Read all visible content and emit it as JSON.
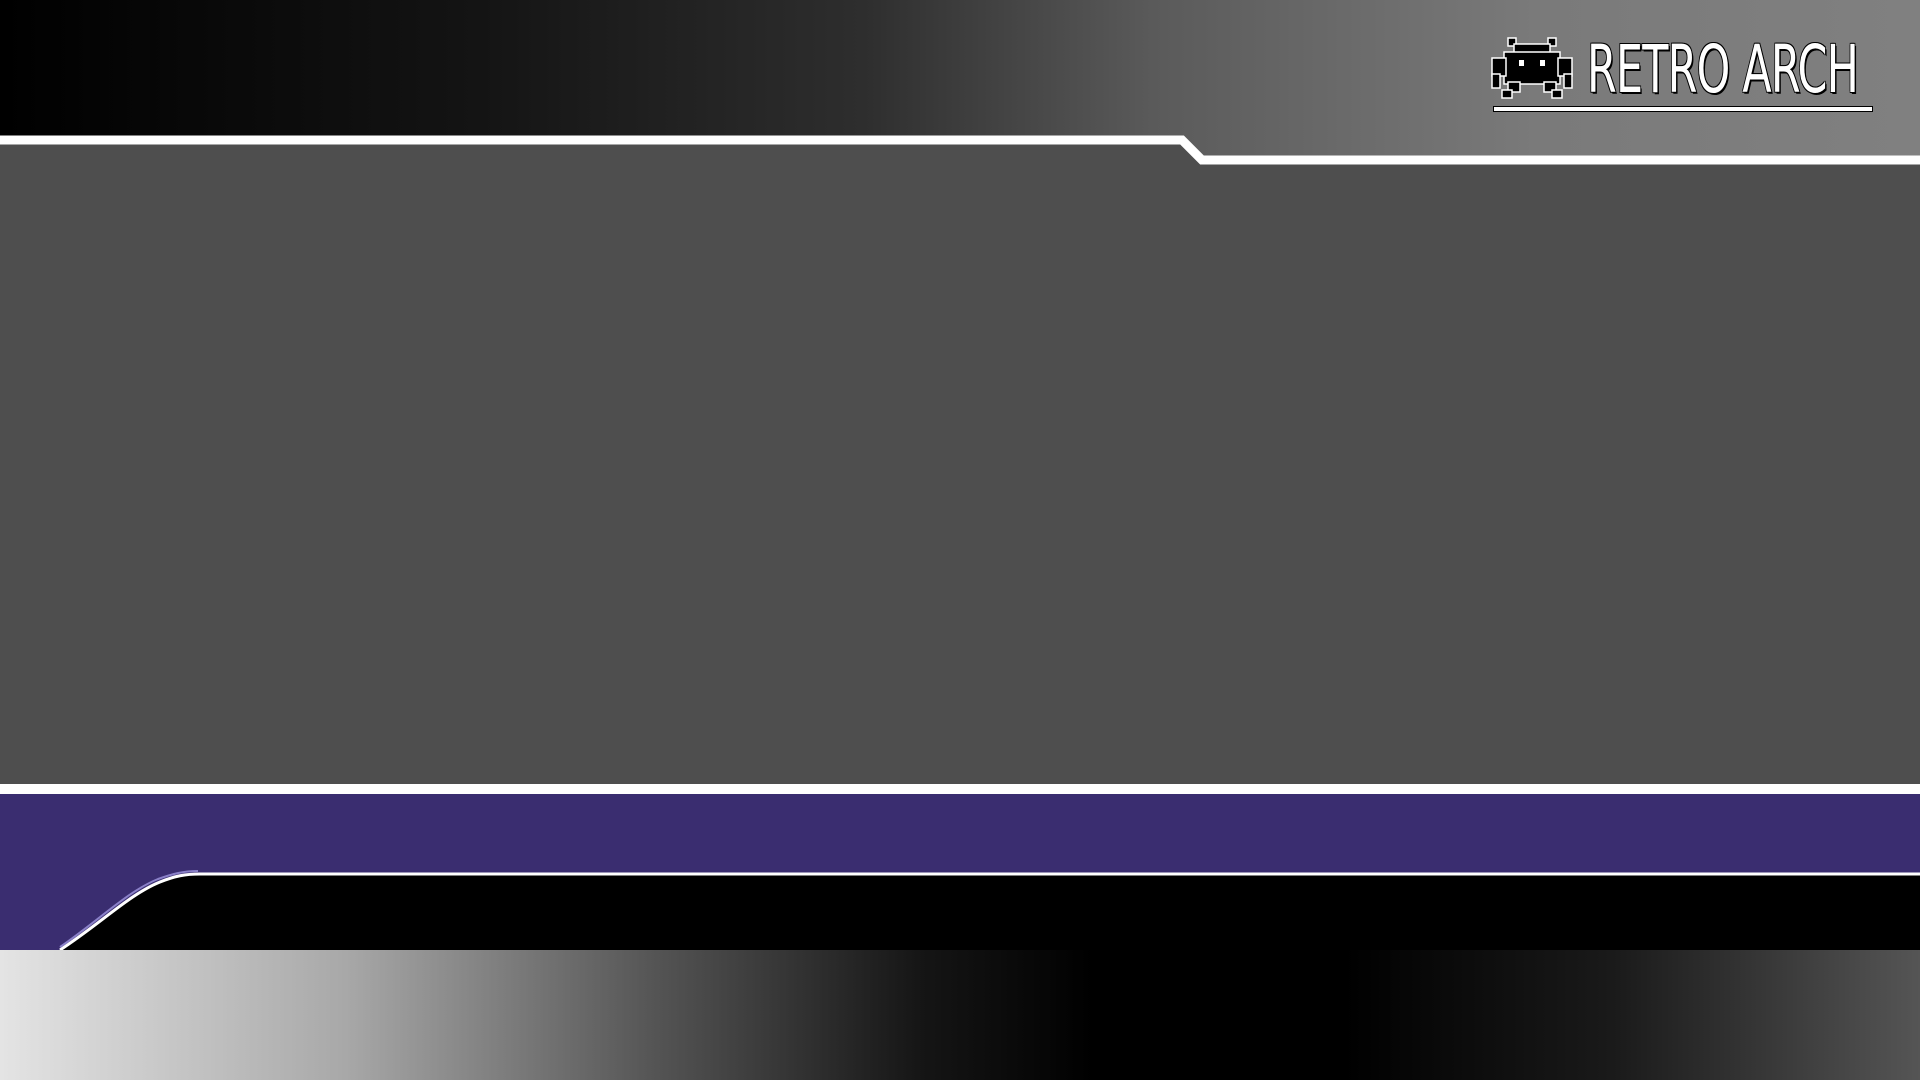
{
  "logo": {
    "text": "RETRO ARCH",
    "icon": "space-invader-icon"
  },
  "colors": {
    "content": "#4e4e4e",
    "accent": "#3a2d70",
    "divider": "#ffffff",
    "footer_dark": "#000000"
  }
}
